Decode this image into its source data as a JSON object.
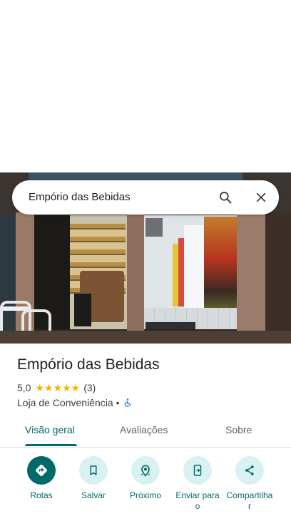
{
  "search": {
    "query": "Empório das Bebidas"
  },
  "place": {
    "name": "Empório das Bebidas",
    "rating": "5,0",
    "stars": "★★★★★",
    "review_count": "(3)",
    "category": "Loja de Conveniência",
    "separator": "•"
  },
  "tabs": [
    {
      "label": "Visão geral",
      "active": true
    },
    {
      "label": "Avaliações",
      "active": false
    },
    {
      "label": "Sobre",
      "active": false
    }
  ],
  "actions": [
    {
      "label": "Rotas",
      "icon": "directions-icon"
    },
    {
      "label": "Salvar",
      "icon": "bookmark-icon"
    },
    {
      "label": "Próximo",
      "icon": "nearby-icon"
    },
    {
      "label": "Enviar para\no",
      "icon": "send-to-phone-icon"
    },
    {
      "label": "Compartilha\nr",
      "icon": "share-icon"
    }
  ],
  "colors": {
    "accent": "#00696c",
    "accent_light": "#d9f1f3",
    "star": "#f4b400"
  }
}
